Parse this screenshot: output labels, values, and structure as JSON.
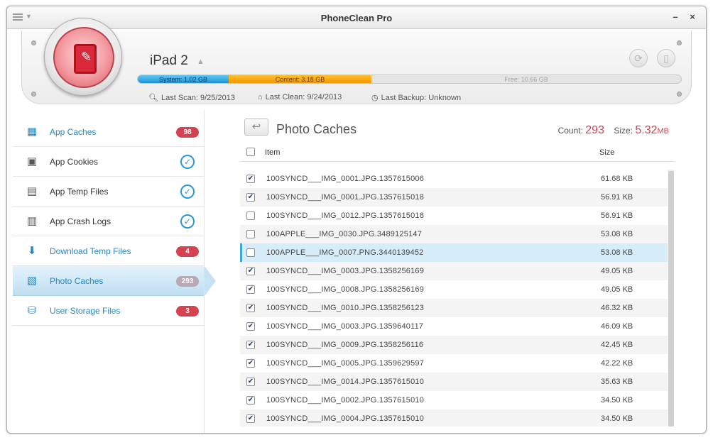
{
  "window": {
    "title": "PhoneClean Pro"
  },
  "device": {
    "name": "iPad 2",
    "storage": {
      "system_label": "System: 1.02 GB",
      "content_label": "Content: 3.18 GB",
      "free_label": "Free: 10.66 GB"
    },
    "last_scan": "Last Scan: 9/25/2013",
    "last_clean": "Last Clean: 9/24/2013",
    "last_backup": "Last Backup: Unknown"
  },
  "sidebar": {
    "items": [
      {
        "label": "App Caches",
        "badge": "98",
        "status": "badge"
      },
      {
        "label": "App Cookies",
        "status": "checked"
      },
      {
        "label": "App Temp Files",
        "status": "checked"
      },
      {
        "label": "App Crash Logs",
        "status": "checked"
      },
      {
        "label": "Download Temp Files",
        "badge": "4",
        "status": "badge"
      },
      {
        "label": "Photo Caches",
        "badge": "293",
        "status": "badge",
        "selected": true
      },
      {
        "label": "User Storage Files",
        "badge": "3",
        "status": "badge"
      }
    ]
  },
  "main": {
    "title": "Photo Caches",
    "count_label": "Count:",
    "count": "293",
    "size_label": "Size:",
    "size_value": "5.32",
    "size_unit": "MB",
    "columns": {
      "item": "Item",
      "size": "Size"
    },
    "rows": [
      {
        "name": "100SYNCD___IMG_0001.JPG.1357615006",
        "size": "61.68 KB",
        "checked": true
      },
      {
        "name": "100SYNCD___IMG_0001.JPG.1357615018",
        "size": "56.91 KB",
        "checked": true
      },
      {
        "name": "100SYNCD___IMG_0012.JPG.1357615018",
        "size": "56.91 KB",
        "checked": false
      },
      {
        "name": "100APPLE___IMG_0030.JPG.3489125147",
        "size": "53.08 KB",
        "checked": false
      },
      {
        "name": "100APPLE___IMG_0007.PNG.3440139452",
        "size": "53.08 KB",
        "checked": false,
        "highlight": true
      },
      {
        "name": "100SYNCD___IMG_0003.JPG.1358256169",
        "size": "49.05 KB",
        "checked": true
      },
      {
        "name": "100SYNCD___IMG_0008.JPG.1358256169",
        "size": "49.05 KB",
        "checked": true
      },
      {
        "name": "100SYNCD___IMG_0010.JPG.1358256123",
        "size": "46.32 KB",
        "checked": true
      },
      {
        "name": "100SYNCD___IMG_0003.JPG.1359640117",
        "size": "46.09 KB",
        "checked": true
      },
      {
        "name": "100SYNCD___IMG_0009.JPG.1358256116",
        "size": "42.45 KB",
        "checked": true
      },
      {
        "name": "100SYNCD___IMG_0005.JPG.1359629597",
        "size": "42.22 KB",
        "checked": true
      },
      {
        "name": "100SYNCD___IMG_0014.JPG.1357615010",
        "size": "35.63 KB",
        "checked": true
      },
      {
        "name": "100SYNCD___IMG_0002.JPG.1357615010",
        "size": "34.50 KB",
        "checked": true
      },
      {
        "name": "100SYNCD___IMG_0004.JPG.1357615010",
        "size": "34.50 KB",
        "checked": true
      }
    ]
  },
  "colors": {
    "accent_blue": "#2487c2",
    "badge_red": "#d64350",
    "system_blue": "#1f93d6",
    "content_orange": "#f59700"
  }
}
